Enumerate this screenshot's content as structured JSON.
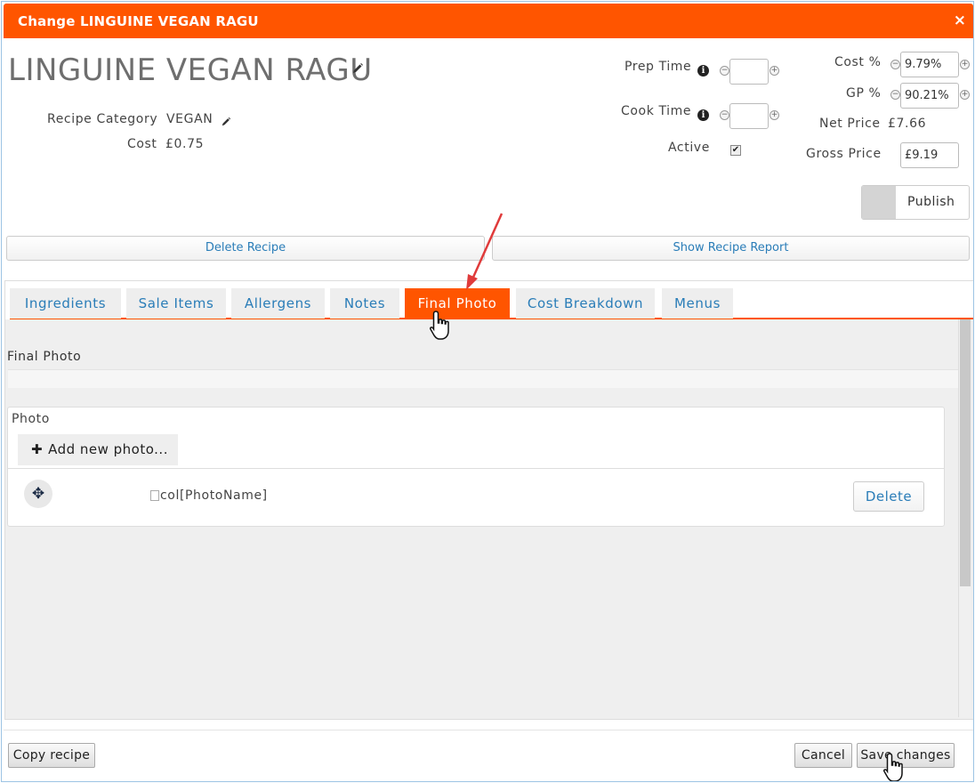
{
  "dialog": {
    "title": "Change LINGUINE VEGAN RAGU",
    "close_symbol": "×"
  },
  "recipe": {
    "name": "LINGUINE VEGAN RAGU",
    "category_label": "Recipe Category",
    "category_value": "VEGAN",
    "cost_label": "Cost",
    "cost_value": "£0.75"
  },
  "times": {
    "prep_label": "Prep Time",
    "prep_value": "",
    "cook_label": "Cook Time",
    "cook_value": "",
    "active_label": "Active",
    "active_checked": true
  },
  "pricing": {
    "cost_pct_label": "Cost %",
    "cost_pct_value": "9.79%",
    "gp_pct_label": "GP %",
    "gp_pct_value": "90.21%",
    "net_price_label": "Net Price",
    "net_price_value": "£7.66",
    "gross_price_label": "Gross Price",
    "gross_price_value": "£9.19"
  },
  "actions": {
    "publish_label": "Publish",
    "delete_recipe": "Delete Recipe",
    "show_report": "Show Recipe Report"
  },
  "tabs": [
    {
      "label": "Ingredients",
      "active": false
    },
    {
      "label": "Sale Items",
      "active": false
    },
    {
      "label": "Allergens",
      "active": false
    },
    {
      "label": "Notes",
      "active": false
    },
    {
      "label": "Final Photo",
      "active": true
    },
    {
      "label": "Cost Breakdown",
      "active": false
    },
    {
      "label": "Menus",
      "active": false
    }
  ],
  "final_photo": {
    "section_title": "Final Photo",
    "photo_label": "Photo",
    "add_photo": "Add new photo...",
    "photo_alt": "col[PhotoName]",
    "delete": "Delete"
  },
  "footer": {
    "copy_recipe": "Copy recipe",
    "cancel": "Cancel",
    "save": "Save changes"
  },
  "colors": {
    "accent": "#ff5500",
    "link": "#2a7db8"
  }
}
